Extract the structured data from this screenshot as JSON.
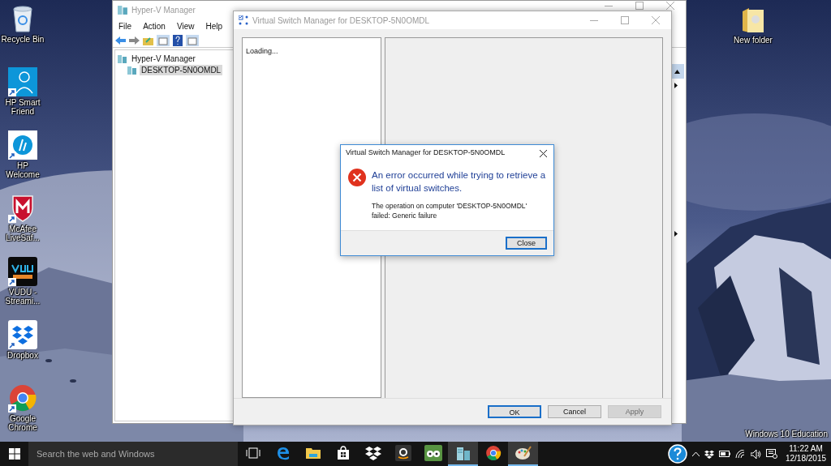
{
  "desktop_icons": [
    {
      "kind": "recycle-bin",
      "label": "Recycle Bin"
    },
    {
      "kind": "hp-smart-friend",
      "label": "HP Smart Friend"
    },
    {
      "kind": "hp-welcome",
      "label": "HP Welcome"
    },
    {
      "kind": "mcafee",
      "label": "McAfee LiveSaf..."
    },
    {
      "kind": "vudu",
      "label": "VUDU - Streami..."
    },
    {
      "kind": "dropbox",
      "label": "Dropbox"
    },
    {
      "kind": "chrome",
      "label": "Google Chrome"
    }
  ],
  "desktop_icons_right": [
    {
      "kind": "folder",
      "label": "New folder"
    }
  ],
  "edition_text": "Windows 10 Education",
  "hyperv": {
    "title": "Hyper-V Manager",
    "menu": [
      "File",
      "Action",
      "View",
      "Help"
    ],
    "tree": [
      {
        "label": "Hyper-V Manager",
        "selected": false,
        "children": [
          {
            "label": "DESKTOP-5N0OMDL",
            "selected": true
          }
        ]
      }
    ]
  },
  "vsm": {
    "title": "Virtual Switch Manager for DESKTOP-5N0OMDL",
    "list_status": "Loading...",
    "buttons": [
      {
        "label": "OK",
        "default": true,
        "disabled": false
      },
      {
        "label": "Cancel",
        "default": false,
        "disabled": false
      },
      {
        "label": "Apply",
        "default": false,
        "disabled": true
      }
    ]
  },
  "error": {
    "title": "Virtual Switch Manager for DESKTOP-5N0OMDL",
    "heading": "An error occurred while trying to retrieve a list of virtual switches.",
    "detail": "The operation on computer 'DESKTOP-5N0OMDL' failed: Generic failure",
    "button": "Close"
  },
  "taskbar": {
    "search_placeholder": "Search the web and Windows",
    "apps": [
      {
        "kind": "task-view",
        "active": false
      },
      {
        "kind": "edge",
        "active": false
      },
      {
        "kind": "explorer",
        "active": false
      },
      {
        "kind": "store",
        "active": false
      },
      {
        "kind": "dropbox",
        "active": false
      },
      {
        "kind": "amazon",
        "active": false
      },
      {
        "kind": "tripadvisor",
        "active": false
      },
      {
        "kind": "hyperv",
        "active": true
      },
      {
        "kind": "chrome",
        "active": false
      },
      {
        "kind": "paint",
        "active": true
      }
    ],
    "time": "11:22 AM",
    "date": "12/18/2015"
  }
}
